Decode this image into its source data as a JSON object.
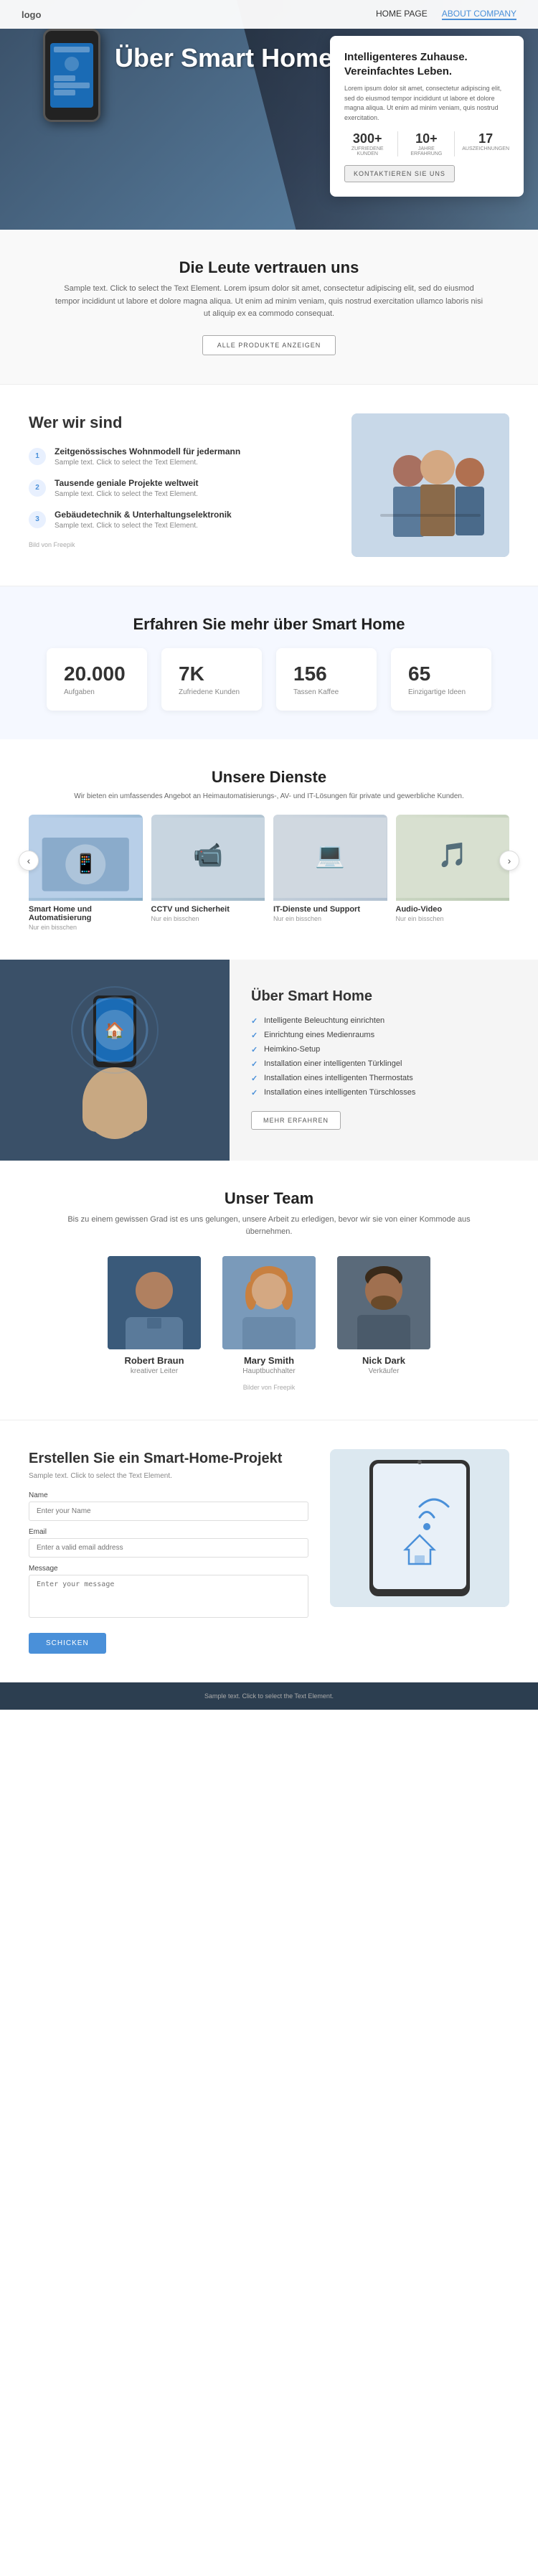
{
  "nav": {
    "logo": "logo",
    "links": [
      {
        "label": "HOME PAGE",
        "active": false
      },
      {
        "label": "ABOUT COMPANY",
        "active": true
      }
    ]
  },
  "hero": {
    "title": "Über Smart Homes",
    "card": {
      "heading": "Intelligenteres Zuhause. Vereinfachtes Leben.",
      "body": "Lorem ipsum dolor sit amet, consectetur adipiscing elit, sed do eiusmod tempor incididunt ut labore et dolore magna aliqua. Ut enim ad minim veniam, quis nostrud exercitation.",
      "stats": [
        {
          "num": "300+",
          "label": "ZUFRIEDENE KUNDEN"
        },
        {
          "num": "10+",
          "label": "JAHRE ERFAHRUNG"
        },
        {
          "num": "17",
          "label": "AUSZEICHNUNGEN"
        }
      ],
      "btn": "KONTAKTIEREN SIE UNS"
    }
  },
  "trust": {
    "title": "Die Leute vertrauen uns",
    "body": "Sample text. Click to select the Text Element. Lorem ipsum dolor sit amet, consectetur adipiscing elit, sed do eiusmod tempor incididunt ut labore et dolore magna aliqua. Ut enim ad minim veniam, quis nostrud exercitation ullamco laboris nisi ut aliquip ex ea commodo consequat.",
    "btn": "ALLE PRODUKTE ANZEIGEN"
  },
  "who": {
    "title": "Wer wir sind",
    "items": [
      {
        "num": "1",
        "title": "Zeitgenössisches Wohnmodell für jedermann",
        "text": "Sample text. Click to select the Text Element."
      },
      {
        "num": "2",
        "title": "Tausende geniale Projekte weltweit",
        "text": "Sample text. Click to select the Text Element."
      },
      {
        "num": "3",
        "title": "Gebäudetechnik & Unterhaltungselektronik",
        "text": "Sample text. Click to select the Text Element."
      }
    ],
    "image_credit": "Bild von Freepik"
  },
  "stats": {
    "title": "Erfahren Sie mehr über Smart Home",
    "items": [
      {
        "num": "20.000",
        "label": "Aufgaben"
      },
      {
        "num": "7K",
        "label": "Zufriedene Kunden"
      },
      {
        "num": "156",
        "label": "Tassen Kaffee"
      },
      {
        "num": "65",
        "label": "Einzigartige Ideen"
      }
    ]
  },
  "services": {
    "title": "Unsere Dienste",
    "description": "Wir bieten ein umfassendes Angebot an Heimautomatisierungs-, AV- und IT-Lösungen für private und gewerbliche Kunden.",
    "items": [
      {
        "label": "Smart Home und Automatisierung",
        "sub": "Nur ein bisschen",
        "icon": "🏠"
      },
      {
        "label": "CCTV und Sicherheit",
        "sub": "Nur ein bisschen",
        "icon": "📹"
      },
      {
        "label": "IT-Dienste und Support",
        "sub": "Nur ein bisschen",
        "icon": "💻"
      },
      {
        "label": "Audio-Video",
        "sub": "Nur ein bisschen",
        "icon": "🎵"
      }
    ],
    "prev": "‹",
    "next": "›"
  },
  "about_smart": {
    "title": "Über Smart Home",
    "checklist": [
      "Intelligente Beleuchtung einrichten",
      "Einrichtung eines Medienraums",
      "Heimkino-Setup",
      "Installation einer intelligenten Türklingel",
      "Installation eines intelligenten Thermostats",
      "Installation eines intelligenten Türschlosses"
    ],
    "btn": "MEHR ERFAHREN"
  },
  "team": {
    "title": "Unser Team",
    "description": "Bis zu einem gewissen Grad ist es uns gelungen, unsere Arbeit zu erledigen, bevor wir sie von einer Kommode aus übernehmen.",
    "members": [
      {
        "name": "Robert Braun",
        "role": "kreativer Leiter"
      },
      {
        "name": "Mary Smith",
        "role": "Hauptbuchhalter"
      },
      {
        "name": "Nick Dark",
        "role": "Verkäufer"
      }
    ],
    "image_credit": "Bilder von Freepik"
  },
  "contact": {
    "title": "Erstellen Sie ein Smart-Home-Projekt",
    "description": "Sample text. Click to select the Text Element.",
    "fields": {
      "name_label": "Name",
      "name_placeholder": "Enter your Name",
      "email_label": "Email",
      "email_placeholder": "Enter a valid email address",
      "message_label": "Message",
      "message_placeholder": "Enter your message"
    },
    "submit_btn": "SCHICKEN"
  },
  "footer": {
    "text": "Sample text. Click to select the Text Element."
  }
}
